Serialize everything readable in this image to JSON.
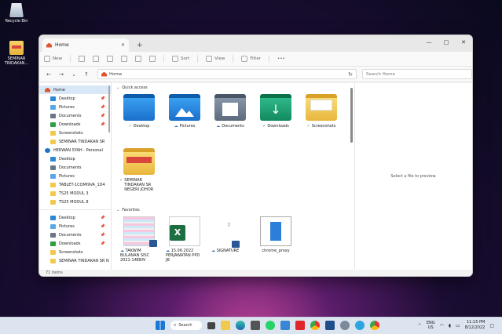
{
  "desktop": {
    "icons": [
      {
        "label": "Recycle Bin"
      },
      {
        "label": "SEMINAR TINDAKAN..."
      }
    ]
  },
  "window": {
    "tab_title": "Home",
    "new_tab": "+",
    "controls": {
      "minimize": "—",
      "maximize": "□",
      "close": "✕"
    },
    "toolbar": {
      "new": "New",
      "sort": "Sort",
      "view": "View",
      "filter": "Filter",
      "more": "•••"
    },
    "address": {
      "path": "Home",
      "search_placeholder": "Search Home"
    },
    "sidebar": {
      "items": [
        {
          "label": "Home",
          "icon": "home-icon",
          "active": true
        },
        {
          "label": "Desktop",
          "icon": "desktop-folder-icon",
          "pinned": true
        },
        {
          "label": "Pictures",
          "icon": "pictures-folder-icon",
          "pinned": true
        },
        {
          "label": "Documents",
          "icon": "documents-folder-icon",
          "pinned": true
        },
        {
          "label": "Downloads",
          "icon": "downloads-folder-icon",
          "pinned": true
        },
        {
          "label": "Screenshots",
          "icon": "folder-icon"
        },
        {
          "label": "SEMINAR TINDAKAN SR",
          "icon": "folder-icon"
        },
        {
          "label": "HERWAN SYAH - Personal",
          "icon": "onedrive-icon"
        },
        {
          "label": "Desktop",
          "icon": "desktop-folder-icon"
        },
        {
          "label": "Documents",
          "icon": "documents-folder-icon"
        },
        {
          "label": "Pictures",
          "icon": "pictures-folder-icon"
        },
        {
          "label": "TABLET-1CQMI9VA_1D4",
          "icon": "folder-icon"
        },
        {
          "label": "TS25 MODUL 3",
          "icon": "folder-icon"
        },
        {
          "label": "TS25 MODUL 8",
          "icon": "folder-icon"
        },
        {
          "label": "Desktop",
          "icon": "desktop-folder-icon",
          "pinned": true
        },
        {
          "label": "Pictures",
          "icon": "pictures-folder-icon",
          "pinned": true
        },
        {
          "label": "Documents",
          "icon": "documents-folder-icon",
          "pinned": true
        },
        {
          "label": "Downloads",
          "icon": "downloads-folder-icon",
          "pinned": true
        },
        {
          "label": "Screenshots",
          "icon": "folder-icon"
        },
        {
          "label": "SEMINAR TINDAKAN SR N",
          "icon": "folder-icon"
        }
      ]
    },
    "quick_access": {
      "heading": "Quick access",
      "items": [
        {
          "label": "Desktop",
          "status": "✓"
        },
        {
          "label": "Pictures",
          "status": "☁"
        },
        {
          "label": "Documents",
          "status": "☁"
        },
        {
          "label": "Downloads",
          "status": "✓"
        },
        {
          "label": "Screenshots",
          "status": "✓"
        },
        {
          "label": "SEMINAR TINDAKAN SR NEGERI JOHOR",
          "status": "✓"
        }
      ]
    },
    "favorites": {
      "heading": "Favorites",
      "items": [
        {
          "label": "TAKWIM BULANAN SISC 2021-14EBIV",
          "status": "☁"
        },
        {
          "label": "15.06.2022 PERJAWATAN PPD JB",
          "status": "☁"
        },
        {
          "label": "SIGNATURE",
          "status": "☁"
        },
        {
          "label": "chrome_proxy",
          "status": ""
        }
      ]
    },
    "preview_text": "Select a file to preview.",
    "status": "71 items"
  },
  "taskbar": {
    "search_label": "Search",
    "lang": "ENG",
    "region": "US",
    "time": "11:15 PM",
    "date": "8/12/2022"
  }
}
